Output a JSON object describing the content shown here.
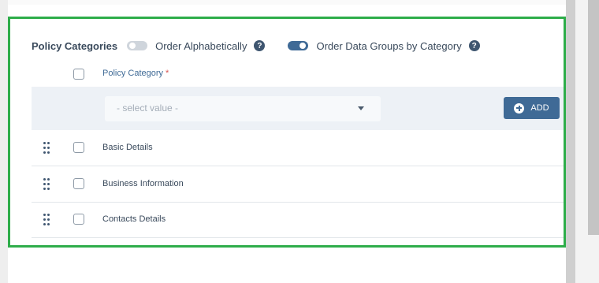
{
  "section": {
    "title": "Policy Categories",
    "toggles": [
      {
        "label": "Order Alphabetically",
        "state": "off"
      },
      {
        "label": "Order Data Groups by Category",
        "state": "on"
      }
    ],
    "help_glyph": "?"
  },
  "table": {
    "column_header": "Policy Category",
    "required_marker": "*",
    "select_placeholder": "- select value -",
    "add_button_label": "ADD",
    "rows": [
      {
        "label": "Basic Details"
      },
      {
        "label": "Business Information"
      },
      {
        "label": "Contacts Details"
      }
    ]
  },
  "colors": {
    "highlight_border": "#2ead4a",
    "accent": "#3f6a96",
    "required": "#d9534f"
  },
  "icons": [
    "help-icon",
    "plus-circle-icon",
    "drag-handle-icon",
    "chevron-down-icon"
  ]
}
